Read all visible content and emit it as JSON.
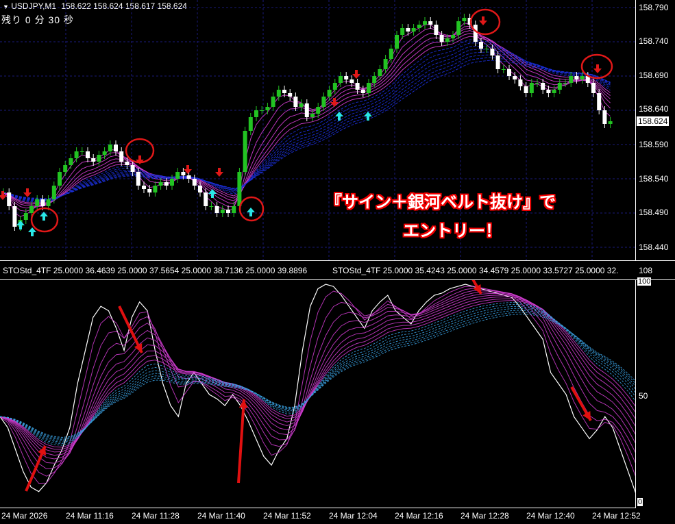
{
  "header": {
    "symbol": "USDJPY,M1",
    "quote": "158.622 158.624 158.617 158.624",
    "countdown": "残り 0 分 30 秒"
  },
  "price_axis": {
    "ticks": [
      "158.790",
      "158.740",
      "158.690",
      "158.640",
      "158.590",
      "158.540",
      "158.490",
      "158.440"
    ],
    "current": "158.624"
  },
  "indicator": {
    "title_1": "STOStd_4TF 25.0000 36.4639 25.0000 37.5654 25.0000 38.7136 25.0000 39.8896",
    "title_2": "STOStd_4TF 25.0000 35.4243 25.0000 34.4579 25.0000 33.5727 25.0000 32.",
    "top_value": "108",
    "level_100": "100",
    "level_50": "50",
    "level_0": "0"
  },
  "time_axis": [
    "24 Mar 2026",
    "24 Mar 11:16",
    "24 Mar 11:28",
    "24 Mar 11:40",
    "24 Mar 11:52",
    "24 Mar 12:04",
    "24 Mar 12:16",
    "24 Mar 12:28",
    "24 Mar 12:40",
    "24 Mar 12:52"
  ],
  "annotation": {
    "line1": "『サイン＋銀河ベルト抜け』で",
    "line2": "エントリー！"
  },
  "colors": {
    "bull": "#22c322",
    "bear": "#ffffff",
    "belt_blue": "#1b2fd6",
    "belt_magenta": "#d03cd0",
    "arrow_up": "#29e6e6",
    "arrow_down": "#e01818",
    "marker": "#e01818",
    "grid": "#1a1a7a"
  }
}
